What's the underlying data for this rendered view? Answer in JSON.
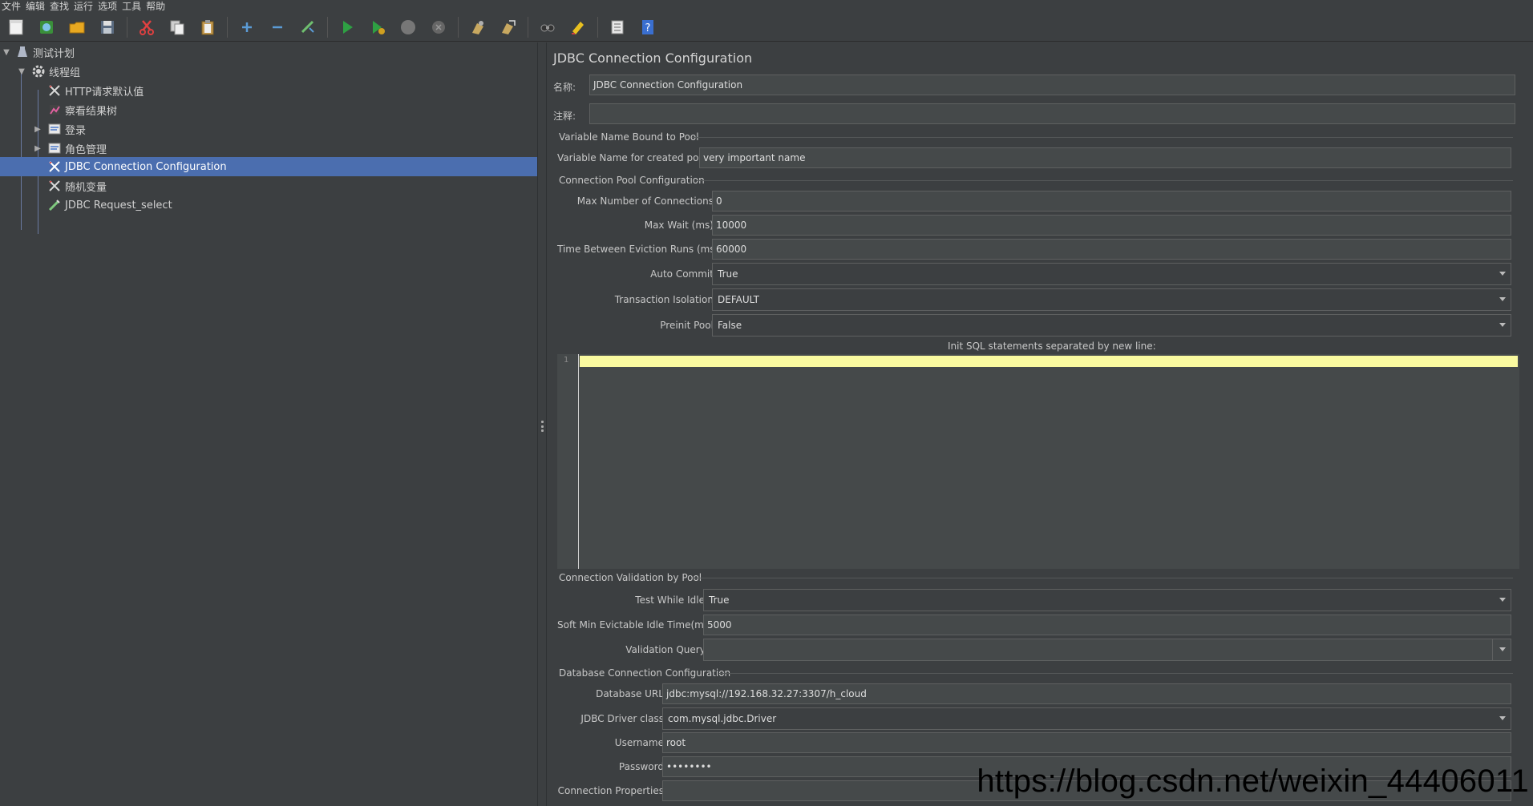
{
  "menu": [
    "文件",
    "编辑",
    "查找",
    "运行",
    "选项",
    "工具",
    "帮助"
  ],
  "toolbar": {
    "icons": [
      "new-icon",
      "templates-icon",
      "open-icon",
      "save-icon",
      "cut-icon",
      "copy-icon",
      "paste-icon",
      "expand-icon",
      "collapse-icon",
      "toggle-icon",
      "start-icon",
      "start-no-pause-icon",
      "stop-icon",
      "shutdown-icon",
      "clear-icon",
      "clear-all-icon",
      "search-icon",
      "reset-search-icon",
      "function-helper-icon",
      "help-icon"
    ]
  },
  "tree": {
    "items": [
      {
        "label": "测试计划",
        "icon": "test-plan-icon",
        "expanded": true
      },
      {
        "label": "线程组",
        "icon": "thread-group-icon",
        "expanded": true
      },
      {
        "label": "HTTP请求默认值",
        "icon": "config-element-icon"
      },
      {
        "label": "察看结果树",
        "icon": "listener-icon"
      },
      {
        "label": "登录",
        "icon": "controller-icon",
        "expanded": false
      },
      {
        "label": "角色管理",
        "icon": "controller-icon",
        "expanded": false
      },
      {
        "label": "JDBC Connection Configuration",
        "icon": "config-element-icon",
        "selected": true
      },
      {
        "label": "随机变量",
        "icon": "config-element-icon"
      },
      {
        "label": "JDBC Request_select",
        "icon": "sampler-icon"
      }
    ]
  },
  "panel": {
    "title": "JDBC Connection Configuration",
    "name_label": "名称:",
    "name_value": "JDBC Connection Configuration",
    "comment_label": "注释:",
    "comment_value": "",
    "var_group": "Variable Name Bound to Pool",
    "var_name_label": "Variable Name for created pool:",
    "var_name_value": "very important name",
    "pool_group": "Connection Pool Configuration",
    "max_conn_label": "Max Number of Connections:",
    "max_conn_value": "0",
    "max_wait_label": "Max Wait (ms):",
    "max_wait_value": "10000",
    "eviction_label": "Time Between Eviction Runs (ms):",
    "eviction_value": "60000",
    "auto_commit_label": "Auto Commit:",
    "auto_commit_value": "True",
    "isolation_label": "Transaction Isolation:",
    "isolation_value": "DEFAULT",
    "preinit_label": "Preinit Pool:",
    "preinit_value": "False",
    "init_sql_label": "Init SQL statements separated by new line:",
    "init_sql_line": "1",
    "validation_group": "Connection Validation by Pool",
    "test_idle_label": "Test While Idle:",
    "test_idle_value": "True",
    "soft_min_label": "Soft Min Evictable Idle Time(ms):",
    "soft_min_value": "5000",
    "validation_query_label": "Validation Query:",
    "validation_query_value": "",
    "db_group": "Database Connection Configuration",
    "db_url_label": "Database URL:",
    "db_url_value": "jdbc:mysql://192.168.32.27:3307/h_cloud",
    "driver_label": "JDBC Driver class:",
    "driver_value": "com.mysql.jdbc.Driver",
    "username_label": "Username:",
    "username_value": "root",
    "password_label": "Password:",
    "password_value": "••••••••",
    "conn_props_label": "Connection Properties:",
    "conn_props_value": ""
  },
  "watermark": "https://blog.csdn.net/weixin_44406011"
}
